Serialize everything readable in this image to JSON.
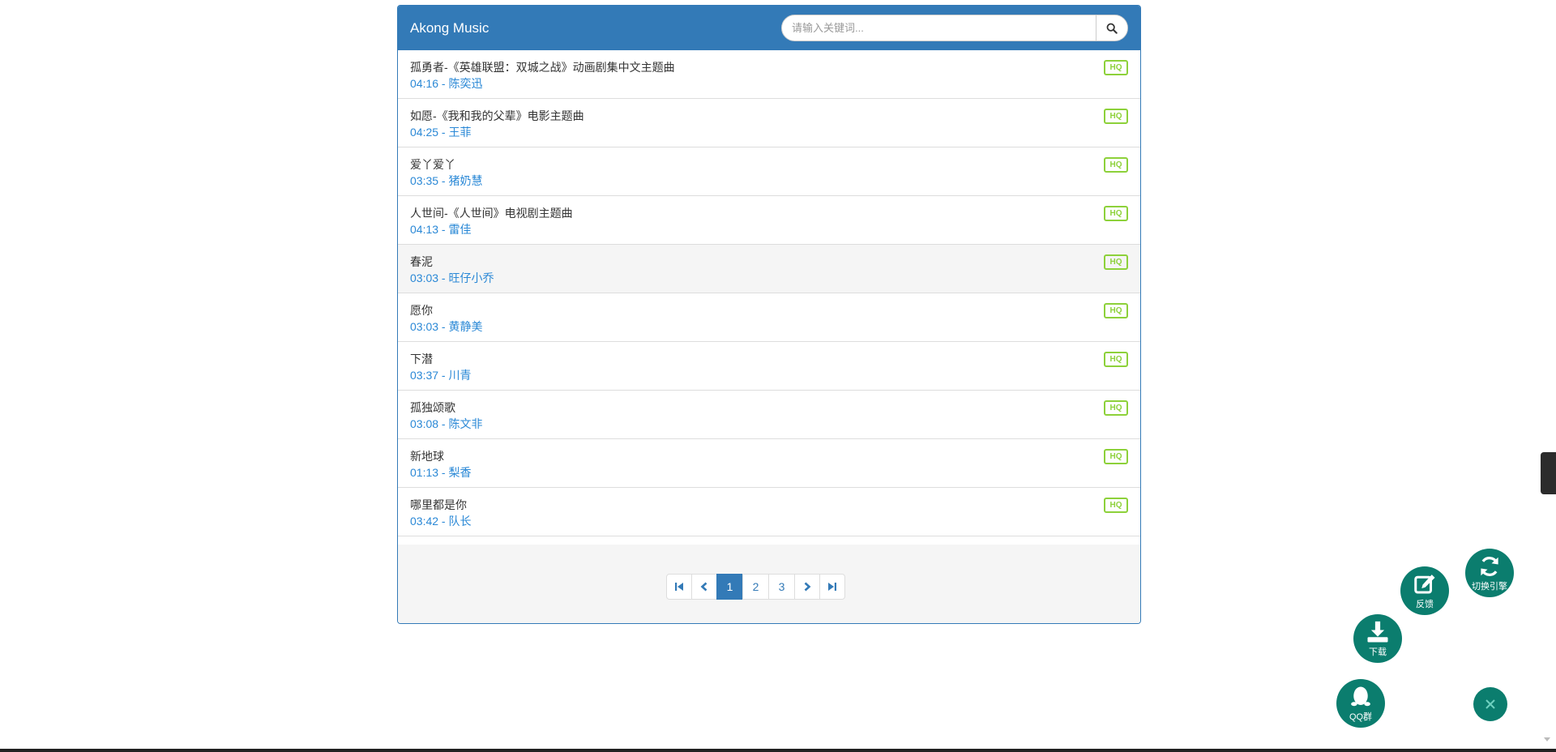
{
  "header": {
    "brand": "Akong Music",
    "search_placeholder": "请输入关键词..."
  },
  "songs": [
    {
      "title": "孤勇者-《英雄联盟：双城之战》动画剧集中文主题曲",
      "meta": "04:16 - 陈奕迅",
      "badge": "HQ"
    },
    {
      "title": "如愿-《我和我的父辈》电影主题曲",
      "meta": "04:25 - 王菲",
      "badge": "HQ"
    },
    {
      "title": "爱丫爱丫",
      "meta": "03:35 - 猪奶慧",
      "badge": "HQ"
    },
    {
      "title": "人世间-《人世间》电视剧主题曲",
      "meta": "04:13 - 雷佳",
      "badge": "HQ"
    },
    {
      "title": "春泥",
      "meta": "03:03 - 旺仔小乔",
      "badge": "HQ"
    },
    {
      "title": "愿你",
      "meta": "03:03 - 黄静美",
      "badge": "HQ"
    },
    {
      "title": "下潜",
      "meta": "03:37 - 川青",
      "badge": "HQ"
    },
    {
      "title": "孤独颂歌",
      "meta": "03:08 - 陈文非",
      "badge": "HQ"
    },
    {
      "title": "新地球",
      "meta": "01:13 - 梨香",
      "badge": "HQ"
    },
    {
      "title": "哪里都是你",
      "meta": "03:42 - 队长",
      "badge": "HQ"
    }
  ],
  "pagination": {
    "pages": [
      "1",
      "2",
      "3"
    ],
    "current": "1"
  },
  "fabs": {
    "switch_label": "切换引擎",
    "feedback_label": "反馈",
    "download_label": "下载",
    "qq_label": "QQ群"
  },
  "colors": {
    "primary": "#337ab7",
    "fab": "#0b7d6e",
    "hq_badge": "#8dd13a",
    "meta_text": "#2a88d6"
  }
}
